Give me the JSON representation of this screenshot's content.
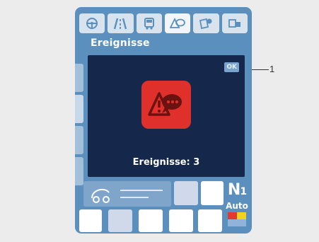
{
  "screen": {
    "title": "Ereignisse",
    "status_badge": "OK",
    "event_count_text": "Ereignisse: 3"
  },
  "tabs": [
    {
      "icon": "steering-wheel-icon",
      "active": false
    },
    {
      "icon": "road-icon",
      "active": false
    },
    {
      "icon": "bus-icon",
      "active": false
    },
    {
      "icon": "warning-bubble-icon",
      "active": true
    },
    {
      "icon": "document-settings-icon",
      "active": false
    },
    {
      "icon": "service-icon",
      "active": false
    }
  ],
  "gear": {
    "letter": "N",
    "number": "1",
    "mode": "Auto"
  },
  "callout": {
    "label": "1"
  },
  "colors": {
    "frame": "#5a8fbe",
    "panel": "#15274a",
    "event_icon_bg": "#e0302b",
    "indicator_red": "#e23a2e",
    "indicator_yellow": "#f2d21a",
    "indicator_blue": "#8fb3d9"
  }
}
